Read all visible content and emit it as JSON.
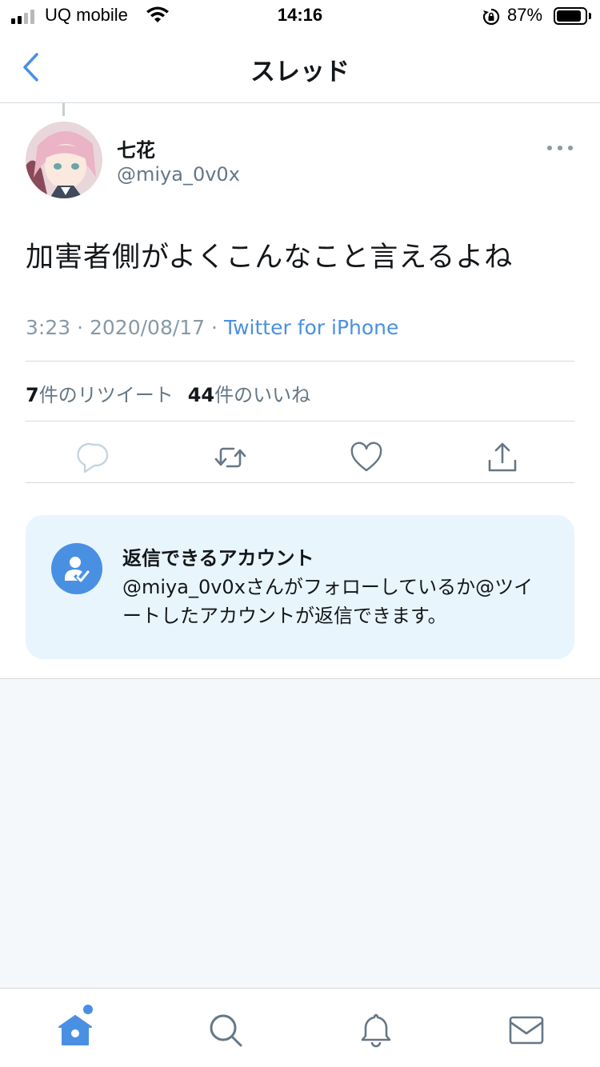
{
  "status_bar": {
    "carrier": "UQ mobile",
    "time": "14:16",
    "battery_percent": "87%",
    "battery_level": 0.87
  },
  "nav": {
    "title": "スレッド",
    "back_icon": "chevron-left-icon"
  },
  "tweet": {
    "display_name": "七花",
    "handle": "@miya_0v0x",
    "text": "加害者側がよくこんなこと言えるよね",
    "time": "3:23",
    "date": "2020/08/17",
    "separator": "·",
    "source": "Twitter for iPhone",
    "retweet_count": "7",
    "retweet_label": "件のリツイート",
    "like_count": "44",
    "like_label": "件のいいね"
  },
  "actions": [
    "reply-icon",
    "retweet-icon",
    "like-icon",
    "share-icon"
  ],
  "reply_restriction": {
    "title": "返信できるアカウント",
    "body": "@miya_0v0xさんがフォローしているか@ツイートしたアカウントが返信できます。",
    "icon": "person-check-icon"
  },
  "tab_bar": [
    "home-icon",
    "search-icon",
    "notifications-icon",
    "messages-icon"
  ],
  "colors": {
    "accent": "#4a90e2",
    "text": "#14171a",
    "secondary": "#8899a6",
    "card_bg": "#e8f5fd",
    "page_bg": "#f5f8fa"
  }
}
